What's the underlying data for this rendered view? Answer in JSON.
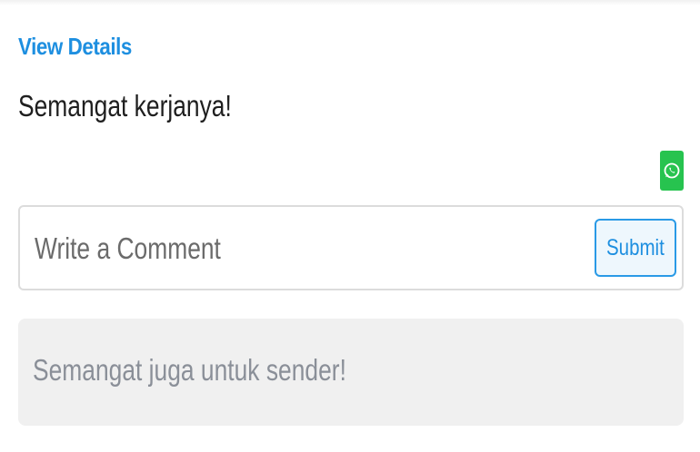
{
  "header": {
    "view_details_label": "View Details"
  },
  "post": {
    "message": "Semangat kerjanya!"
  },
  "share": {
    "whatsapp_icon": "whatsapp-icon",
    "whatsapp_color": "#27c34f"
  },
  "comment": {
    "input_value": "",
    "input_placeholder": "Write a Comment",
    "submit_label": "Submit"
  },
  "reply": {
    "text": "Semangat juga untuk sender!"
  },
  "colors": {
    "accent": "#1e8fe0",
    "reply_background": "#f0f0f0"
  }
}
